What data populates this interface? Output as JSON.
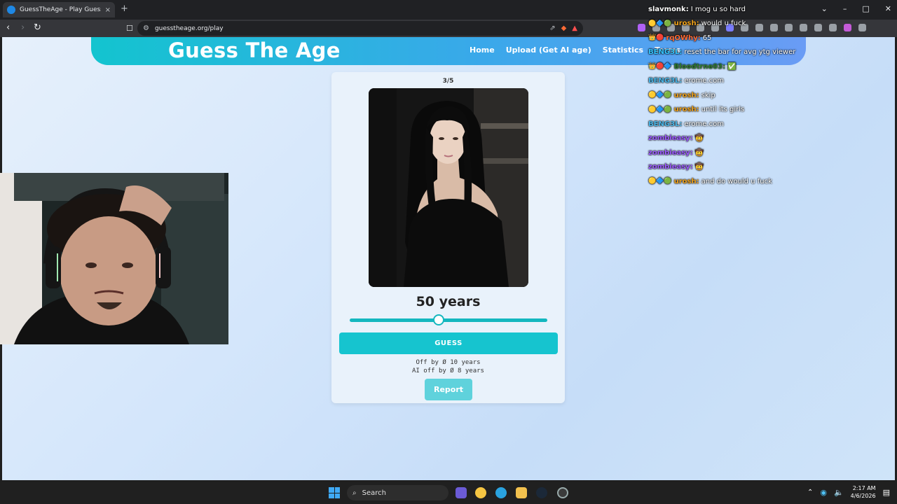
{
  "browser": {
    "tab_title": "GuessTheAge - Play Guess The Age",
    "tab_close": "×",
    "new_tab": "+",
    "url": "guesstheage.org/play",
    "window_controls": [
      "⌄",
      "–",
      "□",
      "✕"
    ]
  },
  "site": {
    "logo": "Guess The Age",
    "nav": [
      "Home",
      "Upload (Get AI age)",
      "Statistics",
      "Terms"
    ]
  },
  "game": {
    "progress": "3/5",
    "age_value": "50 years",
    "slider_fraction": 0.45,
    "guess_label": "GUESS",
    "off_by": "Off by Ø 10 years",
    "ai_off_by": "AI off by Ø 8 years",
    "report_label": "Report"
  },
  "chat": [
    {
      "badges": "",
      "user": "slavmonk:",
      "color": "#ffffff",
      "message": "I mog u so hard"
    },
    {
      "badges": "🟡🔷🟢",
      "user": "urosh:",
      "color": "#f0a21a",
      "message": "would u fuck"
    },
    {
      "badges": "👑🔴",
      "user": "rqOWhy:",
      "color": "#ff6b35",
      "message": "65"
    },
    {
      "badges": "",
      "user": "BENG3L:",
      "color": "#33c4ff",
      "message": "reset the bar for avg ytg viewer"
    },
    {
      "badges": "👑🔴🔷",
      "user": "Bloodtrne03:",
      "color": "#2e7d32",
      "message": "✅"
    },
    {
      "badges": "",
      "user": "BENG3L:",
      "color": "#4ab6e8",
      "message": "erome.com"
    },
    {
      "badges": "🟡🔷🟢",
      "user": "urosh:",
      "color": "#f0a21a",
      "message": "skip"
    },
    {
      "badges": "🟡🔷🟢",
      "user": "urosh:",
      "color": "#f0a21a",
      "message": "until its girls"
    },
    {
      "badges": "",
      "user": "BENG3L:",
      "color": "#4ab6e8",
      "message": "erome.com"
    },
    {
      "badges": "",
      "user": "zombieasy:",
      "color": "#9b59ff",
      "message": "🤠"
    },
    {
      "badges": "",
      "user": "zombieasy:",
      "color": "#9b59ff",
      "message": "🤠"
    },
    {
      "badges": "",
      "user": "zombieasy:",
      "color": "#9b59ff",
      "message": "🤠"
    },
    {
      "badges": "🟡🔷🟢",
      "user": "urosh:",
      "color": "#f0a21a",
      "message": "and do would u fuck"
    }
  ],
  "taskbar": {
    "search_label": "Search",
    "time": "2:17 AM",
    "date": "4/6/2026"
  }
}
